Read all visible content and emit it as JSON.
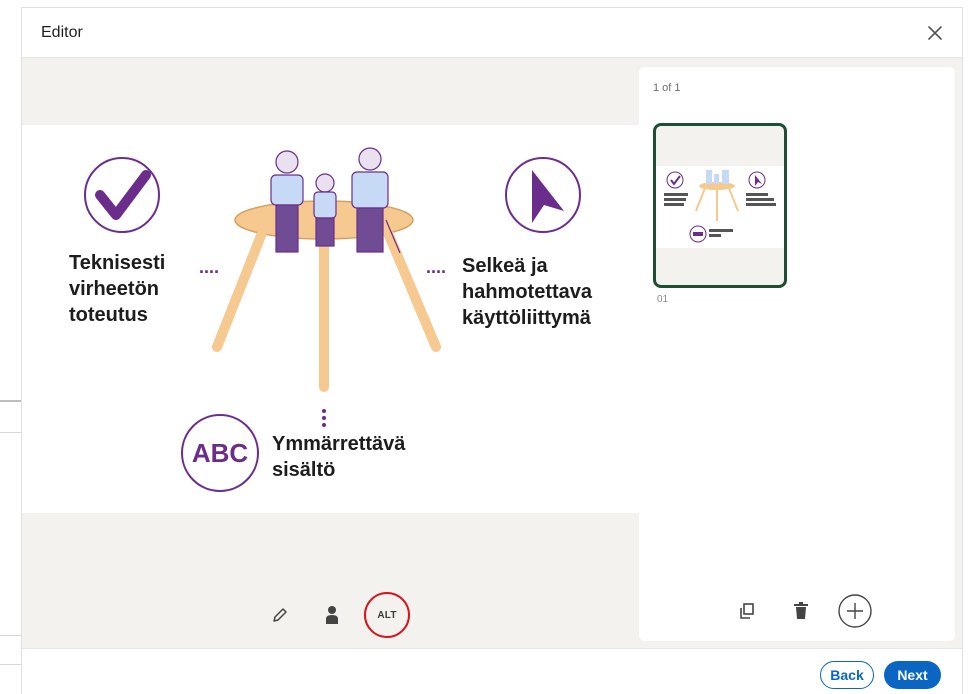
{
  "dialog": {
    "title": "Editor"
  },
  "image": {
    "left_caption": [
      "Teknisesti",
      "virheetön",
      "toteutus"
    ],
    "right_caption": [
      "Selkeä ja",
      "hahmotettava",
      "käyttöliittymä"
    ],
    "bottom_caption": [
      "Ymmärrettävä",
      "sisältö"
    ],
    "abc_text": "ABC",
    "dots": "...."
  },
  "tools": {
    "alt_label": "ALT"
  },
  "panel": {
    "count": "1 of 1",
    "thumb_number": "01"
  },
  "footer": {
    "back_label": "Back",
    "next_label": "Next"
  },
  "colors": {
    "purple": "#6b2d8c",
    "table": "#f5c98f",
    "accent": "#0a66c2",
    "thumb_border": "#1d4f35",
    "alt_ring": "#d7141b"
  }
}
